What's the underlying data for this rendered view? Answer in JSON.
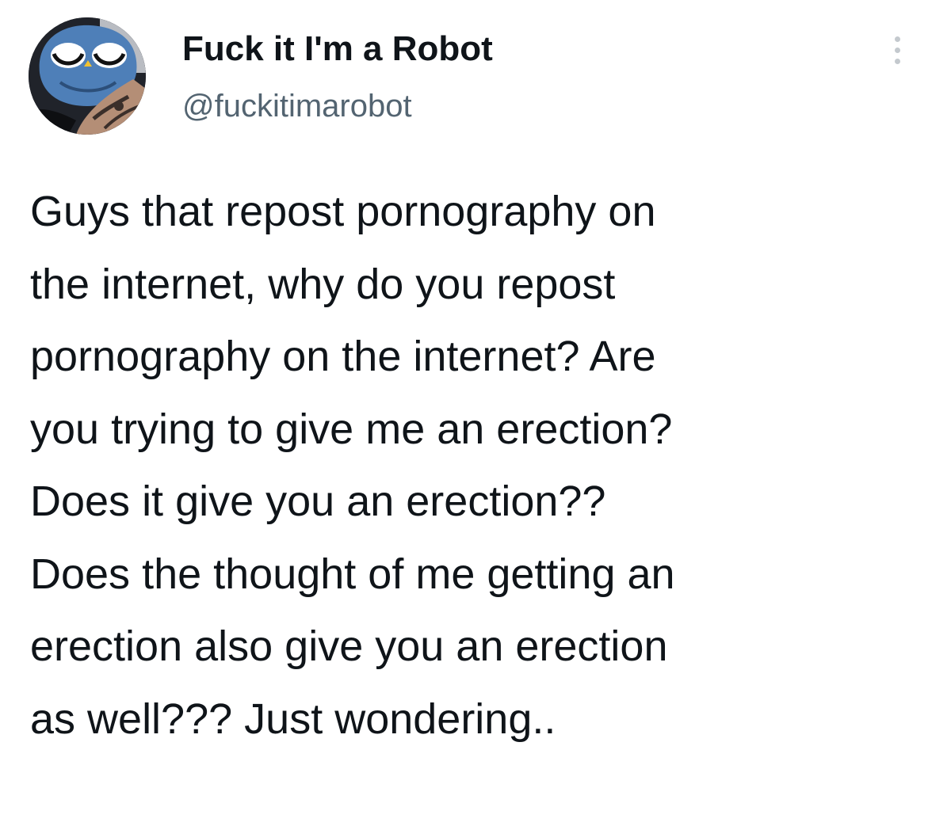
{
  "tweet": {
    "author": {
      "display_name": "Fuck it I'm a Robot",
      "handle": "@fuckitimarobot",
      "avatar_icon": "robot-avatar-icon"
    },
    "more_icon": "more-options-icon",
    "text_lines": [
      "Guys that repost pornography on",
      "the internet, why do you repost",
      "pornography on the internet? Are",
      "you trying to give me an erection?",
      "Does it give you an erection??",
      "Does the thought of me getting an",
      "erection also give you an erection",
      "as well??? Just wondering.."
    ]
  },
  "colors": {
    "text_primary": "#0f1419",
    "text_secondary": "#536471",
    "background": "#ffffff",
    "avatar_blue": "#4e7fb8"
  }
}
